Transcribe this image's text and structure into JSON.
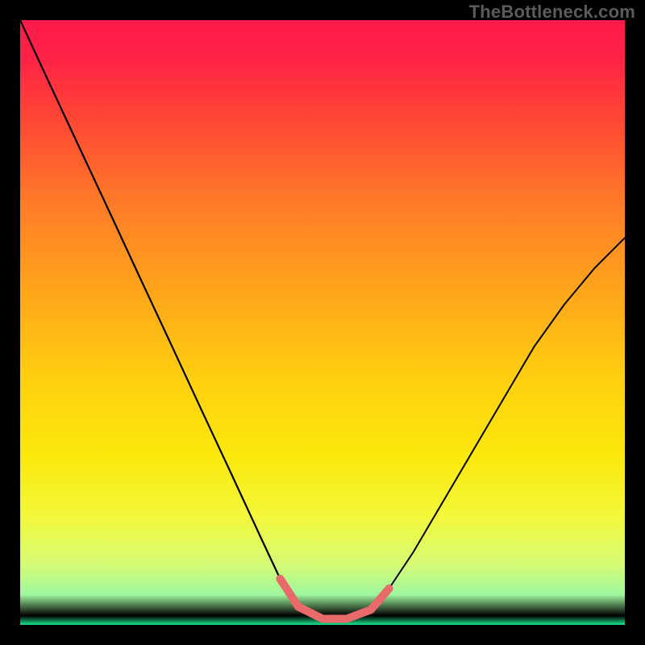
{
  "watermark": "TheBottleneck.com",
  "gradient": {
    "stops": [
      {
        "offset": 0.0,
        "color": "#ff1a4b"
      },
      {
        "offset": 0.06,
        "color": "#ff2247"
      },
      {
        "offset": 0.15,
        "color": "#ff4236"
      },
      {
        "offset": 0.3,
        "color": "#ff7a28"
      },
      {
        "offset": 0.45,
        "color": "#ffa61b"
      },
      {
        "offset": 0.6,
        "color": "#ffd10f"
      },
      {
        "offset": 0.72,
        "color": "#fbe80c"
      },
      {
        "offset": 0.82,
        "color": "#f3f83a"
      },
      {
        "offset": 0.9,
        "color": "#d6fb75"
      },
      {
        "offset": 0.95,
        "color": "#9ef79f"
      },
      {
        "offset": 0.985,
        "color": "#3de f0a8"
      },
      {
        "offset": 1.0,
        "color": "#17e68f"
      }
    ]
  },
  "chart_data": {
    "type": "line",
    "title": "",
    "xlabel": "",
    "ylabel": "",
    "xlim": [
      0,
      1
    ],
    "ylim": [
      0,
      1
    ],
    "annotations": [
      "TheBottleneck.com"
    ],
    "series": [
      {
        "name": "curve",
        "x": [
          0.0,
          0.05,
          0.1,
          0.15,
          0.2,
          0.25,
          0.3,
          0.35,
          0.4,
          0.43,
          0.46,
          0.5,
          0.54,
          0.58,
          0.61,
          0.65,
          0.7,
          0.75,
          0.8,
          0.85,
          0.9,
          0.95,
          1.0
        ],
        "y": [
          1.0,
          0.892,
          0.785,
          0.678,
          0.57,
          0.463,
          0.355,
          0.248,
          0.14,
          0.076,
          0.03,
          0.01,
          0.01,
          0.025,
          0.06,
          0.12,
          0.205,
          0.29,
          0.375,
          0.46,
          0.53,
          0.59,
          0.64
        ],
        "segments": [
          {
            "from": 0,
            "to": 9,
            "color": "#000000",
            "width": 2.2
          },
          {
            "from": 9,
            "to": 14,
            "color": "#e86a6a",
            "width": 10
          },
          {
            "from": 14,
            "to": 22,
            "color": "#000000",
            "width": 2.0
          }
        ]
      }
    ]
  }
}
